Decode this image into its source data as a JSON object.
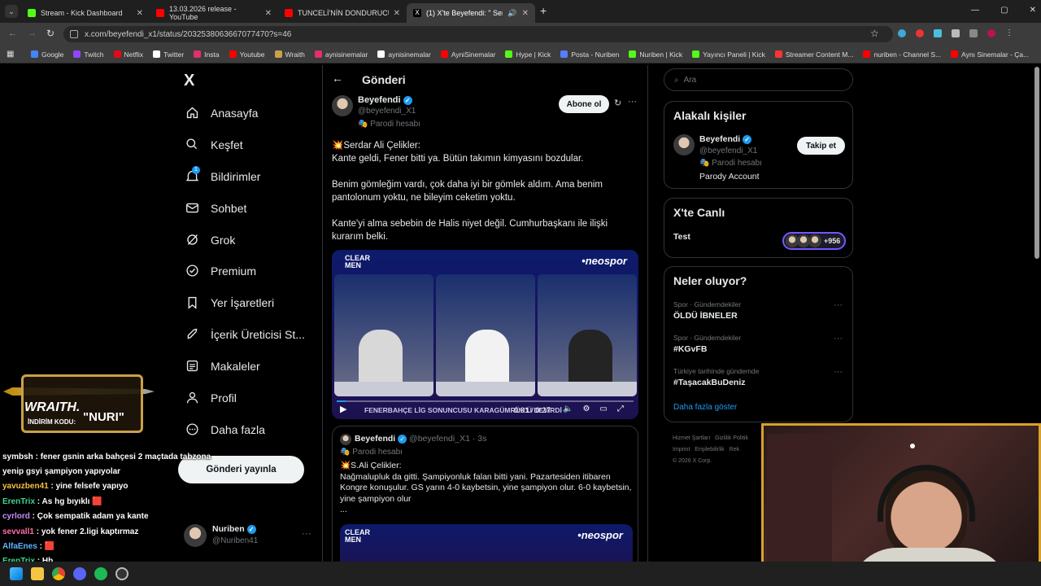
{
  "browser": {
    "tabs": [
      {
        "title": "Stream - Kick Dashboard",
        "color": "#53fc18"
      },
      {
        "title": "13.03.2026 release - YouTube",
        "color": "#ff0000"
      },
      {
        "title": "TUNCELİ'NİN DONDURUCU SO",
        "color": "#ff0000"
      },
      {
        "title": "(1) X'te Beyefendi: \" Serd",
        "color": "#ffffff"
      }
    ],
    "url": "x.com/beyefendi_x1/status/2032538063667077470?s=46",
    "bookmarks": [
      "Google",
      "Twitch",
      "Netflix",
      "Twitter",
      "Insta",
      "Youtube",
      "Wraith",
      "aynisinemalar",
      "aynisinemalar",
      "AyniSinemalar",
      "Hype | Kick",
      "Posta - Nuriben",
      "Nuriben | Kick",
      "Yayıncı Paneli | Kick",
      "Streamer Content M...",
      "nuriben - Channel S...",
      "Aynı Sinemalar - Ça..."
    ]
  },
  "nav": {
    "logo": "X",
    "items": [
      {
        "label": "Anasayfa",
        "icon": "home-icon"
      },
      {
        "label": "Keşfet",
        "icon": "search-icon"
      },
      {
        "label": "Bildirimler",
        "icon": "bell-icon"
      },
      {
        "label": "Sohbet",
        "icon": "mail-icon"
      },
      {
        "label": "Grok",
        "icon": "grok-icon"
      },
      {
        "label": "Premium",
        "icon": "premium-icon"
      },
      {
        "label": "Yer İşaretleri",
        "icon": "bookmark-icon"
      },
      {
        "label": "İçerik Üreticisi St...",
        "icon": "rocket-icon"
      },
      {
        "label": "Makaleler",
        "icon": "article-icon"
      },
      {
        "label": "Profil",
        "icon": "person-icon"
      },
      {
        "label": "Daha fazla",
        "icon": "more-icon"
      }
    ],
    "notification_badge": "1",
    "post_button": "Gönderi yayınla",
    "account": {
      "name": "Nuriben",
      "handle": "@Nuriben41"
    }
  },
  "main": {
    "header": "Gönderi",
    "post": {
      "name": "Beyefendi",
      "handle": "@beyefendi_X1",
      "parody": "Parodi hesabı",
      "subscribe": "Abone ol",
      "paragraphs": [
        "💥Serdar Ali Çelikler:",
        "Kante geldi, Fener bitti ya. Bütün takımın kimyasını bozdular.",
        "Benim gömleğim vardı, çok daha iyi bir gömlek aldım. Ama benim pantolonum yoktu, ne bileyim ceketim yoktu.",
        "Kante'yi alma sebebin de Halis niyet değil. Cumhurbaşkanı ile ilişki kurarım belki."
      ],
      "video": {
        "brand_left": "CLEAR MEN",
        "brand_right": "•neospor",
        "ticker": "FENERBAHÇE LİG SONUNCUSU KARAGÜMRÜK'Ü DEVİRDİ",
        "time": "0:01 / 0:27"
      }
    },
    "quote": {
      "name": "Beyefendi",
      "handle": "@beyefendi_X1 · 3s",
      "parody": "Parodi hesabı",
      "lines": [
        "💥S.Ali Çelikler:",
        "Nağmalupluk da gitti. Şampiyonluk falan bitti yani. Pazartesiden itibaren Kongre konuşulur. GS yarın 4-0 kaybetsin, yine şampiyon olur. 6-0 kaybetsin, yine şampiyon olur",
        "..."
      ],
      "brand_left": "CLEAR MEN",
      "brand_right": "•neospor"
    }
  },
  "sidebar": {
    "search_placeholder": "Ara",
    "related": {
      "title": "Alakalı kişiler",
      "name": "Beyefendi",
      "handle": "@beyefendi_X1",
      "parody": "Parodi hesabı",
      "bio": "Parody Account",
      "follow": "Takip et"
    },
    "live": {
      "title": "X'te Canlı",
      "item": "Test",
      "count": "+956"
    },
    "trends": {
      "title": "Neler oluyor?",
      "items": [
        {
          "meta": "Spor · Gündemdekiler",
          "name": "ÖLDÜ İBNELER"
        },
        {
          "meta": "Spor · Gündemdekiler",
          "name": "#KGvFB"
        },
        {
          "meta": "Türkiye tarihinde gündemde",
          "name": "#TaşacakBuDeniz"
        }
      ],
      "more": "Daha fazla göster"
    },
    "footer": [
      "Hizmet Şartları",
      "Gizlilik Politik",
      "Imprint",
      "Erişilebilirlik",
      "Rek",
      "© 2026 X Corp."
    ]
  },
  "overlay": {
    "sponsor": {
      "name": "WRAITH.",
      "code_label": "İNDİRİM KODU:",
      "code": "\"NURI\""
    },
    "chat": [
      {
        "user": "symbsh",
        "msg": "fener gsnin arka bahçesi 2 maçtada tabzona",
        "color": "#ffffff"
      },
      {
        "user": "",
        "msg": "yenip gsyi şampiyon yapıyolar",
        "color": "#ffffff"
      },
      {
        "user": "yavuzben41",
        "msg": "yine felsefe yapıyo",
        "color": "#f5c242"
      },
      {
        "user": "ErenTrix",
        "msg": "As hg bıyıklı 🟥",
        "color": "#3dd68c"
      },
      {
        "user": "cyrlord",
        "msg": "Çok sempatik adam ya kante",
        "color": "#c58cff"
      },
      {
        "user": "sevvall1",
        "msg": "yok fener 2.ligi kaptırmaz",
        "color": "#ff6fa8"
      },
      {
        "user": "AlfaEnes",
        "msg": "🟥",
        "color": "#5fb3ff"
      },
      {
        "user": "ErenTrix",
        "msg": "Hb",
        "color": "#3dd68c"
      }
    ]
  },
  "colors": {
    "accent": "#1d9bf0",
    "border": "#2f3336",
    "muted": "#71767b",
    "cam_border": "#d9a12a"
  }
}
